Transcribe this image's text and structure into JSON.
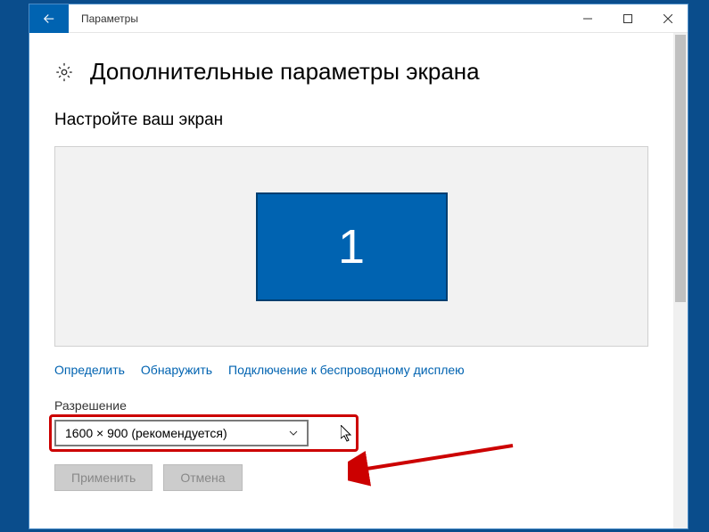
{
  "window": {
    "title": "Параметры"
  },
  "page": {
    "heading": "Дополнительные параметры экрана",
    "section_title": "Настройте ваш экран"
  },
  "monitor": {
    "number": "1"
  },
  "links": {
    "identify": "Определить",
    "detect": "Обнаружить",
    "wireless": "Подключение к беспроводному дисплею"
  },
  "resolution": {
    "label": "Разрешение",
    "selected": "1600 × 900 (рекомендуется)"
  },
  "buttons": {
    "apply": "Применить",
    "cancel": "Отмена"
  }
}
